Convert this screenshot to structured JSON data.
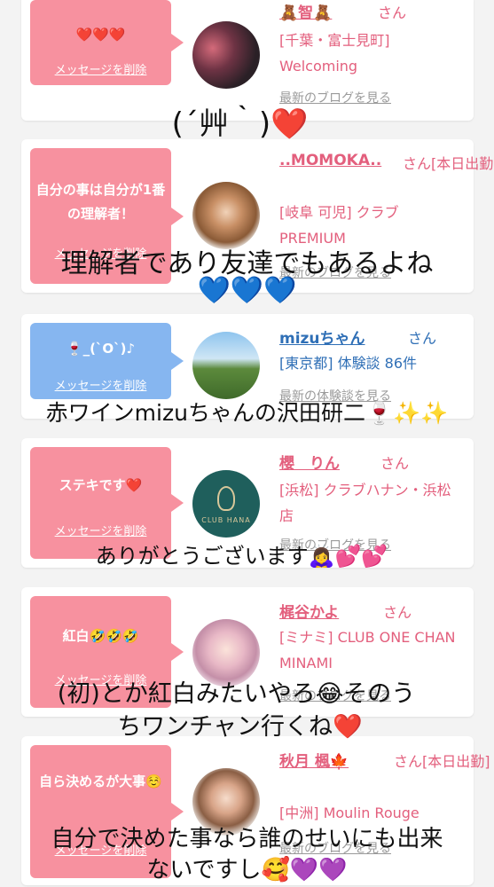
{
  "cards": [
    {
      "message": "❤️❤️❤️",
      "delete_label": "メッセージを削除",
      "name": "🧸智🧸",
      "suffix": "さん",
      "info": "[千葉・富士見町] Welcoming",
      "blog": "最新のブログを見る",
      "bubble_color": "#f7919f"
    },
    {
      "message": "自分の事は自分が1番の理解者！",
      "delete_label": "メッセージを削除",
      "name": "..MOMOKA..",
      "suffix": "さん[本日出勤]",
      "info": "[岐阜 可児] クラブPREMIUM",
      "blog": "最新のブログを見る",
      "bubble_color": "#f7919f"
    },
    {
      "message": "🍷_(`O`)♪",
      "delete_label": "メッセージを削除",
      "name": "mizuちゃん",
      "suffix": "さん",
      "info": "[東京都] 体験談 86件",
      "blog": "最新の体験談を見る",
      "bubble_color": "#86b6f0"
    },
    {
      "message": "ステキです❤️",
      "delete_label": "メッセージを削除",
      "name": "櫻　りん",
      "suffix": "さん",
      "info": "[浜松] クラブハナン・浜松店",
      "blog": "最新のブログを見る",
      "avatar_text": "CLUB HANA",
      "bubble_color": "#f7919f"
    },
    {
      "message": "紅白🤣🤣🤣",
      "delete_label": "メッセージを削除",
      "name": "梶谷かよ",
      "suffix": "さん",
      "info": "[ミナミ] CLUB ONE CHAN MINAMI",
      "blog": "最新のブログを見る",
      "bubble_color": "#f7919f"
    },
    {
      "message": "自ら決めるが大事☺️",
      "delete_label": "メッセージを削除",
      "name": "秋月 楓🍁",
      "suffix": "さん[本日出勤]",
      "info": "[中洲] Moulin Rouge",
      "blog": "最新のブログを見る",
      "bubble_color": "#f7919f"
    }
  ],
  "overlays": [
    "(´艸｀)❤️",
    "理解者であり友達でもあるよね",
    "💙💙💙",
    "赤ワインmizuちゃんの沢田研二🍷✨✨",
    "ありがとうございます🙇‍♀️💕💕",
    "(初)とか紅白みたいやろ😂そのう",
    "ちワンチャン行くね❤️",
    "自分で決めた事なら誰のせいにも出来",
    "ないですし🥰💜💜"
  ]
}
